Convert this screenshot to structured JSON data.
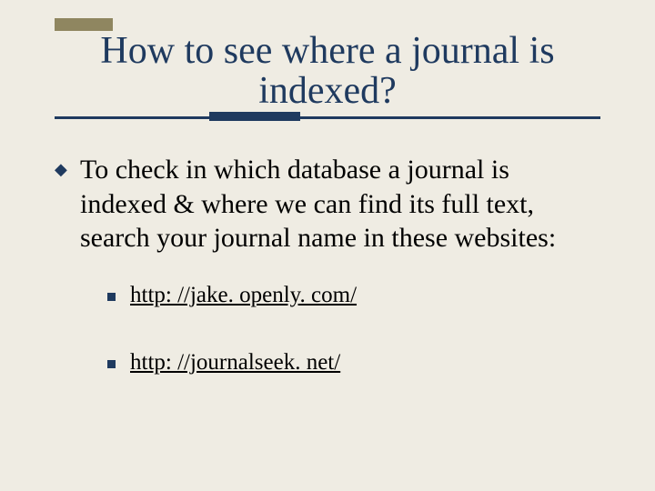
{
  "title": "How to see where a journal is indexed?",
  "main_bullet": "To check in which database a journal is indexed & where we can find its full text, search your journal name in these websites:",
  "links": [
    "http: //jake. openly. com/",
    "http: //journalseek. net/"
  ]
}
